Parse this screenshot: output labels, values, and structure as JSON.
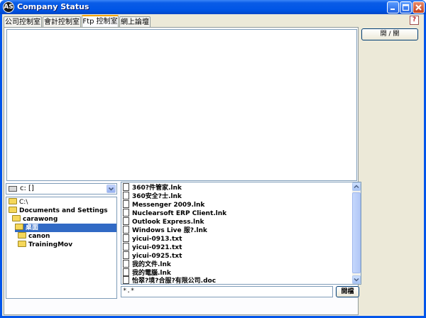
{
  "window": {
    "title": "Company Status",
    "app_icon_text": "AS"
  },
  "tabs": [
    {
      "label": "公司控制室",
      "active": false
    },
    {
      "label": "會計控制室",
      "active": false
    },
    {
      "label": "Ftp 控制室",
      "active": true
    },
    {
      "label": "網上論壇",
      "active": false
    }
  ],
  "help_label": "?",
  "side": {
    "toggle_label": "開 / 關"
  },
  "drive": {
    "value": "c: []"
  },
  "tree": [
    {
      "label": "C:\\"
    },
    {
      "label": "Documents and Settings"
    },
    {
      "label": "carawong"
    },
    {
      "label": "桌面",
      "selected": true
    },
    {
      "label": "canon"
    },
    {
      "label": "TrainingMov"
    }
  ],
  "files": [
    "360?件管家.lnk",
    "360安全?士.lnk",
    "Messenger 2009.lnk",
    "Nuclearsoft ERP Client.lnk",
    "Outlook Express.lnk",
    "Windows Live 服?.lnk",
    "yicui-0913.txt",
    "yicui-0921.txt",
    "yicui-0925.txt",
    "我的文件.lnk",
    "我的電腦.lnk",
    "怡翠?境?合服?有限公司.doc"
  ],
  "filter": {
    "value": "*.*"
  },
  "open_button_label": "開檔"
}
